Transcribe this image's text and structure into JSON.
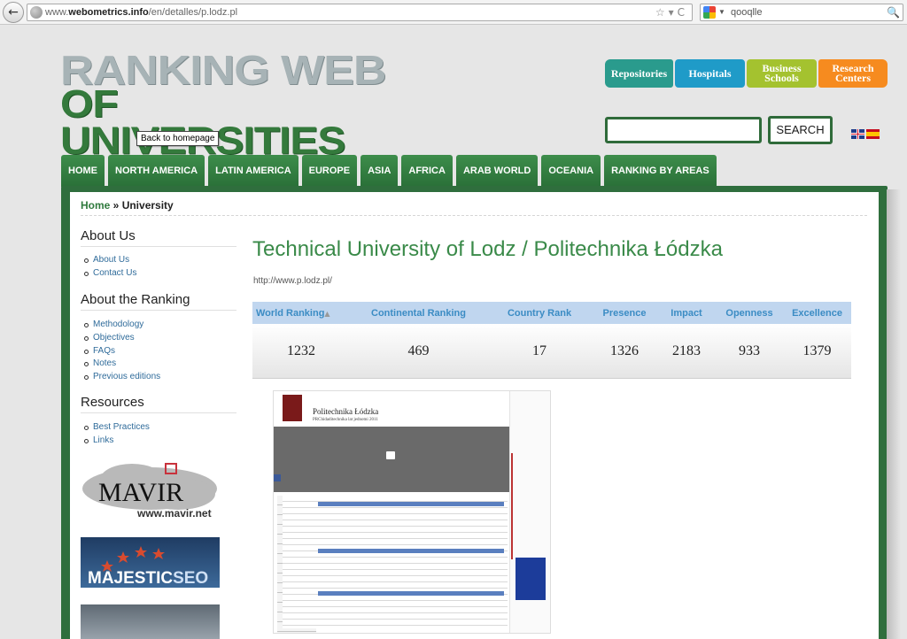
{
  "browser": {
    "url_prefix": "www.",
    "url_domain": "webometrics.info",
    "url_path": "/en/detalles/p.lodz.pl",
    "search_value": "qooqlle",
    "back_glyph": "←",
    "url_icons": "☆▾C",
    "search_icon": "🔍"
  },
  "logo": {
    "line1": "RANKING WEB",
    "line2": "OF UNIVERSITIES",
    "tooltip": "Back to homepage"
  },
  "categories": {
    "repositories": "Repositories",
    "hospitals": "Hospitals",
    "business_1": "Business",
    "business_2": "Schools",
    "research_1": "Research",
    "research_2": "Centers"
  },
  "search": {
    "button": "SEARCH",
    "value": ""
  },
  "nav": [
    "HOME",
    "NORTH AMERICA",
    "LATIN AMERICA",
    "EUROPE",
    "ASIA",
    "AFRICA",
    "ARAB WORLD",
    "OCEANIA",
    "RANKING BY AREAS"
  ],
  "breadcrumb": {
    "home": "Home",
    "sep": " » ",
    "current": "University"
  },
  "sidebar": {
    "about_us": {
      "heading": "About Us",
      "items": [
        "About Us",
        "Contact Us"
      ]
    },
    "about_ranking": {
      "heading": "About the Ranking",
      "items": [
        "Methodology",
        "Objectives",
        "FAQs",
        "Notes",
        "Previous editions"
      ]
    },
    "resources": {
      "heading": "Resources",
      "items": [
        "Best Practices",
        "Links"
      ]
    },
    "banners": {
      "mavir_logo": "MAVIR",
      "mavir_url": "www.mavir.net",
      "majestic_1": "MAJESTIC",
      "majestic_2": "SEO"
    }
  },
  "university": {
    "title": "Technical University of Lodz / Politechnika Łódzka",
    "url": "http://www.p.lodz.pl/"
  },
  "ranking": {
    "headers": [
      "World Ranking",
      "Continental Ranking",
      "Country Rank",
      "Presence",
      "Impact",
      "Openness",
      "Excellence"
    ],
    "sort_glyph": "▲",
    "values": [
      "1232",
      "469",
      "17",
      "1326",
      "2183",
      "933",
      "1379"
    ]
  },
  "thumbnail": {
    "name": "Politechnika Łódzka",
    "sub": "PRChidaditechnika lat jednotni 2011"
  },
  "colors": {
    "green": "#2f6e3d",
    "title_green": "#3a8a49",
    "header_blue": "#c0d6ef",
    "header_text": "#3b8cc4"
  }
}
